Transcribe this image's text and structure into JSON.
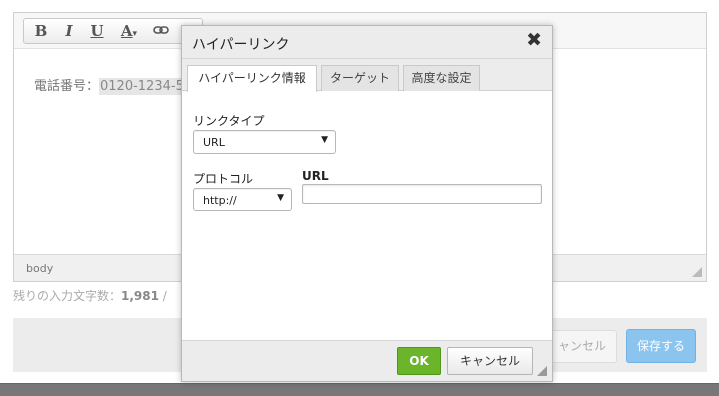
{
  "editor": {
    "toolbar": {
      "bold": "B",
      "italic": "I",
      "underline": "U",
      "text_color": "A",
      "text_color_caret": "▾",
      "link": "🔗"
    },
    "content": {
      "label": "電話番号：",
      "value": "0120-1234-5"
    },
    "status_path": "body"
  },
  "char_count": {
    "label": "残りの入力文字数：",
    "value": "1,981",
    "suffix": " /"
  },
  "page_footer": {
    "cancel_label": "ャンセル",
    "save_label": "保存する"
  },
  "dialog": {
    "title": "ハイパーリンク",
    "close_glyph": "✖",
    "tabs": [
      {
        "label": "ハイパーリンク情報"
      },
      {
        "label": "ターゲット"
      },
      {
        "label": "高度な設定"
      }
    ],
    "link_type": {
      "label": "リンクタイプ",
      "value": "URL"
    },
    "protocol": {
      "label": "プロトコル",
      "value": "http://"
    },
    "url": {
      "label": "URL",
      "value": ""
    },
    "ok_label": "OK",
    "cancel_label": "キャンセル"
  },
  "colors": {
    "ok_green": "#6bb52a",
    "save_blue": "#8cc4f0",
    "dialog_header": "#ececec"
  }
}
